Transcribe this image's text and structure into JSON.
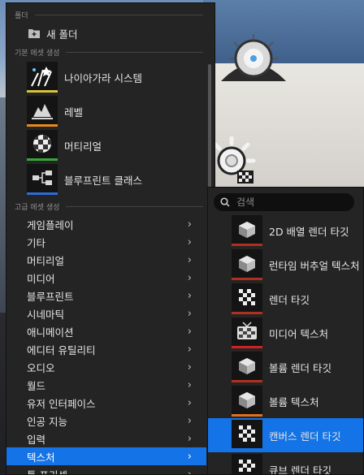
{
  "menu": {
    "folder_section": "폴더",
    "new_folder": "새 폴더",
    "basic_section": "기본 에셋 생성",
    "basic_assets": [
      {
        "label": "나이아가라 시스템",
        "icon": "niagara-icon",
        "color": "#d9c33a"
      },
      {
        "label": "레벨",
        "icon": "level-icon",
        "color": "#e88a1a"
      },
      {
        "label": "머티리얼",
        "icon": "material-icon",
        "color": "#3aa53a"
      },
      {
        "label": "블루프린트 클래스",
        "icon": "blueprint-icon",
        "color": "#2f6ad6"
      }
    ],
    "advanced_section": "고급 에셋 생성",
    "advanced_items": [
      "게임플레이",
      "기타",
      "머티리얼",
      "미디어",
      "블루프린트",
      "시네마틱",
      "애니메이션",
      "에디터 유틸리티",
      "오디오",
      "월드",
      "유저 인터페이스",
      "인공 지능",
      "입력",
      "텍스처",
      "툴 프리셋"
    ],
    "selected_index": 13
  },
  "submenu": {
    "search_placeholder": "검색",
    "items": [
      {
        "label": "2D 배열 렌더 타깃",
        "icon": "render-target-icon",
        "color": "#b03020"
      },
      {
        "label": "런타임 버추얼 텍스처",
        "icon": "virtual-texture-icon",
        "color": "#b03020"
      },
      {
        "label": "렌더 타깃",
        "icon": "render-target-checker-icon",
        "color": "#b03020"
      },
      {
        "label": "미디어 텍스처",
        "icon": "media-texture-icon",
        "color": "#d02020"
      },
      {
        "label": "볼륨 렌더 타깃",
        "icon": "volume-render-target-icon",
        "color": "#b03020"
      },
      {
        "label": "볼륨 텍스처",
        "icon": "volume-texture-icon",
        "color": "#e0701a"
      },
      {
        "label": "캔버스 렌더 타깃",
        "icon": "canvas-render-target-icon",
        "color": "#1473e6"
      },
      {
        "label": "큐브 렌더 타깃",
        "icon": "cube-render-target-icon",
        "color": "#b03020"
      }
    ],
    "selected_index": 6
  },
  "colors": {
    "accent": "#1473e6",
    "menu_bg": "#242424"
  }
}
